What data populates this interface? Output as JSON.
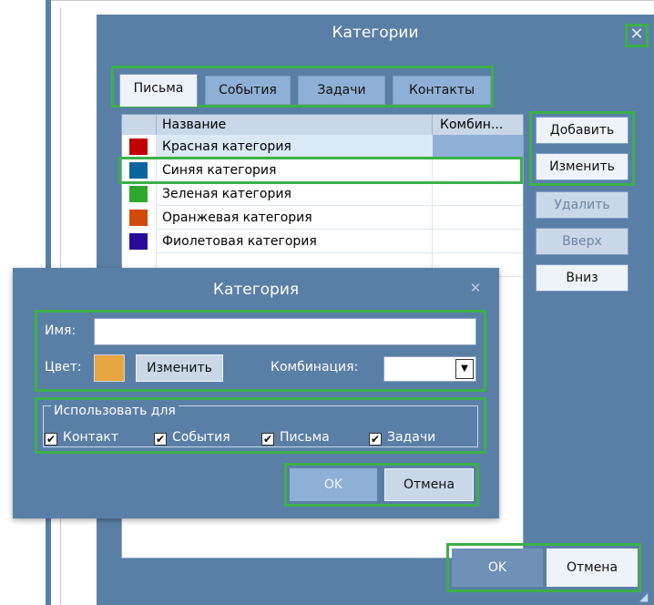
{
  "main_dialog": {
    "title": "Категории",
    "close_glyph": "✕",
    "tabs": [
      {
        "label": "Письма",
        "active": true
      },
      {
        "label": "События",
        "active": false
      },
      {
        "label": "Задачи",
        "active": false
      },
      {
        "label": "Контакты",
        "active": false
      }
    ],
    "list": {
      "columns": [
        "Название",
        "Комбин..."
      ],
      "rows": [
        {
          "name": "Красная категория",
          "color": "#c00000",
          "selected": true
        },
        {
          "name": "Синяя категория",
          "color": "#0a64a0",
          "selected": false
        },
        {
          "name": "Зеленая категория",
          "color": "#2fa82f",
          "selected": false
        },
        {
          "name": "Оранжевая категория",
          "color": "#d04a0a",
          "selected": false
        },
        {
          "name": "Фиолетовая категория",
          "color": "#2a0a9a",
          "selected": false
        }
      ]
    },
    "side_buttons": {
      "add": "Добавить",
      "edit": "Изменить",
      "delete": "Удалить",
      "up": "Вверх",
      "down": "Вниз"
    },
    "ok": "OK",
    "cancel": "Отмена"
  },
  "sub_dialog": {
    "title": "Категория",
    "close_glyph": "✕",
    "name_label": "Имя:",
    "name_value": "",
    "color_label": "Цвет:",
    "color_value": "#e8a640",
    "color_change": "Изменить",
    "combo_label": "Комбинация:",
    "combo_arrow": "▼",
    "use_for_legend": "Использовать для",
    "use_for": [
      {
        "label": "Контакт",
        "checked": true
      },
      {
        "label": "События",
        "checked": true
      },
      {
        "label": "Письма",
        "checked": true
      },
      {
        "label": "Задачи",
        "checked": true
      }
    ],
    "check_glyph": "✔",
    "ok": "OK",
    "cancel": "Отмена"
  },
  "colors": {
    "dialog_bg": "#5a7fa6",
    "highlight": "#3cb04a",
    "selected_row": "#dbe8f6"
  }
}
